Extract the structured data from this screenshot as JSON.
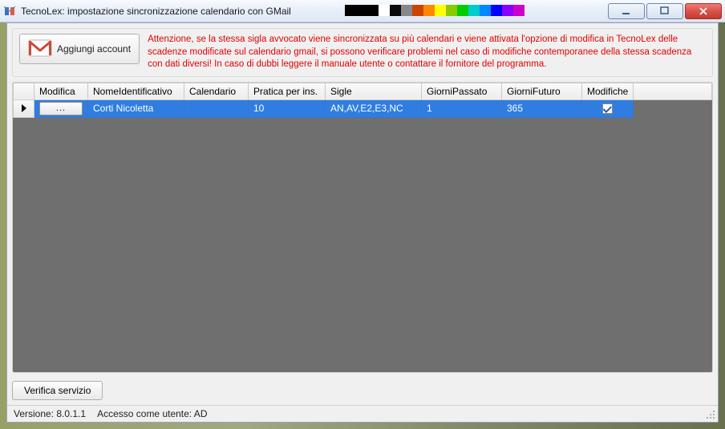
{
  "window": {
    "title": "TecnoLex: impostazione sincronizzazione calendario con GMail"
  },
  "toolbar": {
    "add_account_label": "Aggiungi account"
  },
  "warning_text": "Attenzione, se la stessa sigla avvocato viene sincronizzata su più calendari e viene attivata l'opzione di modifica in TecnoLex delle scadenze modificate sul calendario gmail, si possono verificare problemi nel caso di modifiche contemporanee della stessa scadenza con dati diversi! In caso di dubbi leggere il manuale utente o contattare il fornitore del programma.",
  "grid": {
    "columns": {
      "modifica": "Modifica",
      "nome": "NomeIdentificativo",
      "calendario": "Calendario",
      "pratica": "Pratica per ins.",
      "sigle": "Sigle",
      "passato": "GiorniPassato",
      "futuro": "GiorniFuturo",
      "modifiche": "Modifiche"
    },
    "rows": [
      {
        "edit_button": "...",
        "nome": "Corti Nicoletta",
        "calendario": "",
        "pratica": "10",
        "sigle": "AN,AV,E2,E3,NC",
        "passato": "1",
        "futuro": "365",
        "modifiche_checked": true
      }
    ]
  },
  "buttons": {
    "verify": "Verifica servizio"
  },
  "status": {
    "version_label": "Versione: 8.0.1.1",
    "user_label": "Accesso come utente: AD"
  },
  "title_colors": [
    "#000",
    "#000",
    "#000",
    "#fff",
    "#0b0b0b",
    "#888",
    "#c40",
    "#f80",
    "#ff0",
    "#8c0",
    "#0c0",
    "#0cc",
    "#08f",
    "#00f",
    "#80f",
    "#c0c"
  ]
}
